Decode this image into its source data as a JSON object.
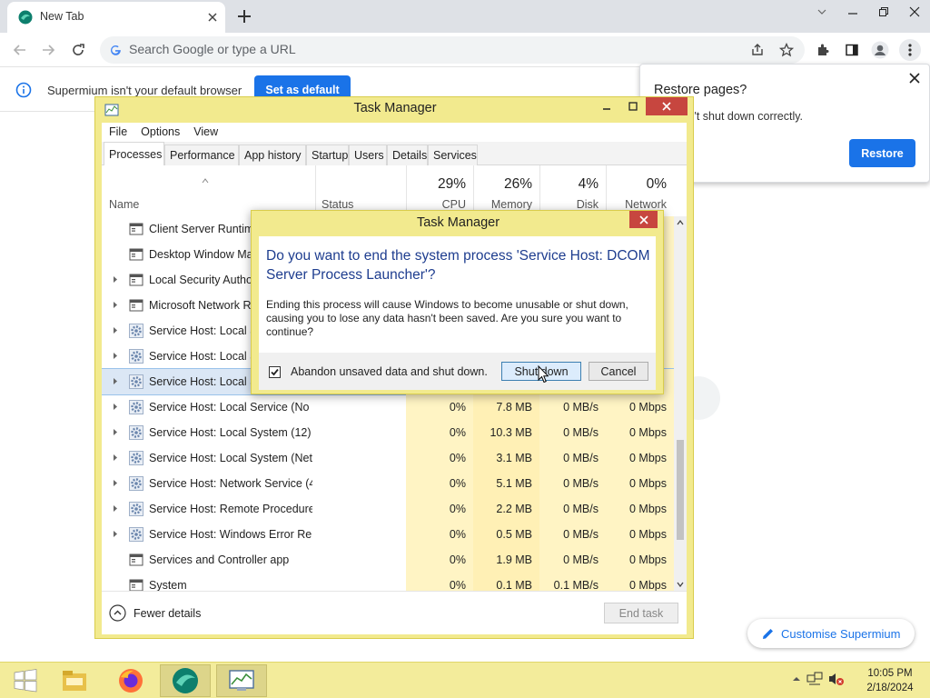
{
  "browser": {
    "tab_title": "New Tab",
    "omnibox_placeholder": "Search Google or type a URL",
    "infobar_text": "Supermium isn't your default browser",
    "set_default_label": "Set as default",
    "restore_title": "Restore pages?",
    "restore_text": "um didn't shut down correctly.",
    "restore_button": "Restore",
    "customise_label": "Customise Supermium",
    "accent_color": "#1a73e8"
  },
  "task_manager": {
    "title": "Task Manager",
    "menu": [
      "File",
      "Options",
      "View"
    ],
    "tabs": [
      "Processes",
      "Performance",
      "App history",
      "Startup",
      "Users",
      "Details",
      "Services"
    ],
    "active_tab": "Processes",
    "header": {
      "name": "Name",
      "status": "Status",
      "cpu_pct": "29%",
      "cpu": "CPU",
      "mem_pct": "26%",
      "mem": "Memory",
      "disk_pct": "4%",
      "disk": "Disk",
      "net_pct": "0%",
      "net": "Network"
    },
    "rows": [
      {
        "name": "Client Server Runtime",
        "expand": false,
        "icon": "window-icon",
        "cpu": "",
        "mem": "",
        "disk": "",
        "net": ""
      },
      {
        "name": "Desktop Window Mar",
        "expand": false,
        "icon": "window-icon",
        "cpu": "",
        "mem": "",
        "disk": "",
        "net": ""
      },
      {
        "name": "Local Security Author",
        "expand": true,
        "icon": "window-icon",
        "cpu": "",
        "mem": "",
        "disk": "",
        "net": ""
      },
      {
        "name": "Microsoft Network Re",
        "expand": true,
        "icon": "window-icon",
        "cpu": "",
        "mem": "",
        "disk": "",
        "net": ""
      },
      {
        "name": "Service Host: Local Se",
        "expand": true,
        "icon": "gear-icon",
        "cpu": "",
        "mem": "",
        "disk": "",
        "net": ""
      },
      {
        "name": "Service Host: Local Se",
        "expand": true,
        "icon": "gear-icon",
        "cpu": "",
        "mem": "",
        "disk": "",
        "net": ""
      },
      {
        "name": "Service Host: Local Se",
        "expand": true,
        "icon": "gear-icon",
        "cpu": "",
        "mem": "",
        "disk": "",
        "net": "",
        "selected": true
      },
      {
        "name": "Service Host: Local Service (No ...",
        "expand": true,
        "icon": "gear-icon",
        "cpu": "0%",
        "mem": "7.8 MB",
        "disk": "0 MB/s",
        "net": "0 Mbps"
      },
      {
        "name": "Service Host: Local System (12)",
        "expand": true,
        "icon": "gear-icon",
        "cpu": "0%",
        "mem": "10.3 MB",
        "disk": "0 MB/s",
        "net": "0 Mbps"
      },
      {
        "name": "Service Host: Local System (Net...",
        "expand": true,
        "icon": "gear-icon",
        "cpu": "0%",
        "mem": "3.1 MB",
        "disk": "0 MB/s",
        "net": "0 Mbps"
      },
      {
        "name": "Service Host: Network Service (4)",
        "expand": true,
        "icon": "gear-icon",
        "cpu": "0%",
        "mem": "5.1 MB",
        "disk": "0 MB/s",
        "net": "0 Mbps"
      },
      {
        "name": "Service Host: Remote Procedure...",
        "expand": true,
        "icon": "gear-icon",
        "cpu": "0%",
        "mem": "2.2 MB",
        "disk": "0 MB/s",
        "net": "0 Mbps"
      },
      {
        "name": "Service Host: Windows Error Re...",
        "expand": true,
        "icon": "gear-icon",
        "cpu": "0%",
        "mem": "0.5 MB",
        "disk": "0 MB/s",
        "net": "0 Mbps"
      },
      {
        "name": "Services and Controller app",
        "expand": false,
        "icon": "window-icon",
        "cpu": "0%",
        "mem": "1.9 MB",
        "disk": "0 MB/s",
        "net": "0 Mbps"
      },
      {
        "name": "System",
        "expand": false,
        "icon": "window-icon",
        "cpu": "0%",
        "mem": "0.1 MB",
        "disk": "0.1 MB/s",
        "net": "0 Mbps"
      }
    ],
    "fewer_details": "Fewer details",
    "end_task": "End task"
  },
  "dialog": {
    "title": "Task Manager",
    "heading": "Do you want to end the system process 'Service Host: DCOM Server Process Launcher'?",
    "body": "Ending this process will cause Windows to become unusable or shut down, causing you to lose any data hasn't been saved. Are you sure you want to continue?",
    "checkbox_label": "Abandon unsaved data and shut down.",
    "checkbox_checked": true,
    "shutdown_label": "Shut down",
    "cancel_label": "Cancel"
  },
  "taskbar": {
    "time": "10:05 PM",
    "date": "2/18/2024",
    "color": "#f3ec9b"
  }
}
